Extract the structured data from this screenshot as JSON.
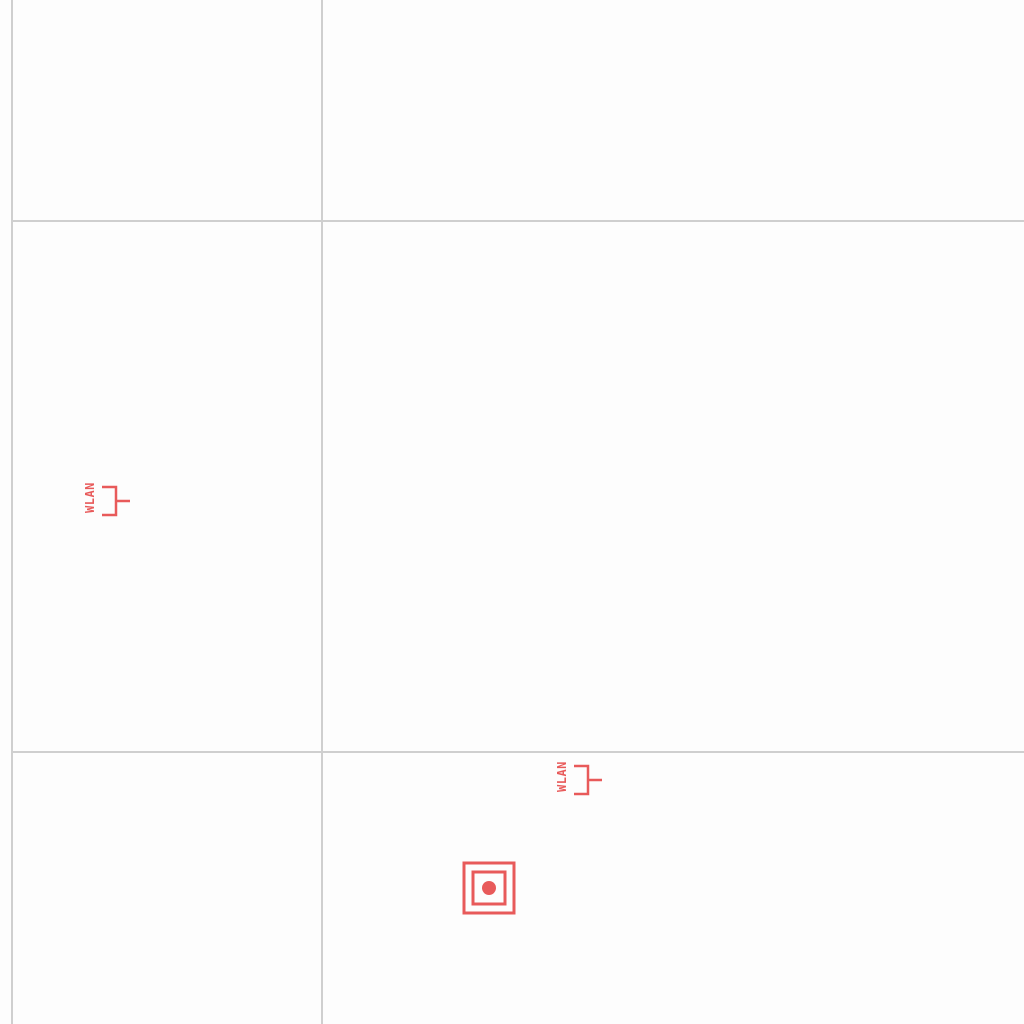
{
  "plan": {
    "wall_color": "#cfcfcf",
    "symbol_color": "#e85a5a"
  },
  "symbols": {
    "wlan_1": {
      "label": "WLAN",
      "icon": "network-outlet-icon"
    },
    "wlan_2": {
      "label": "WLAN",
      "icon": "network-outlet-icon"
    },
    "target": {
      "icon": "target-square-icon"
    }
  }
}
